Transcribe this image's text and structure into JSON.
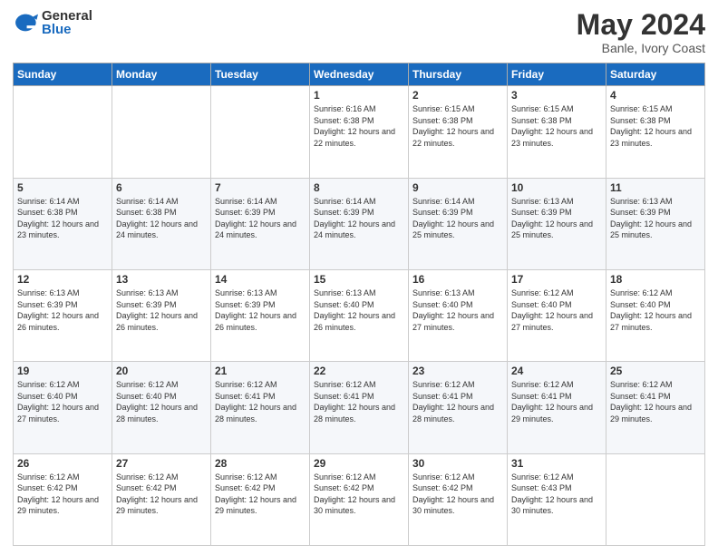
{
  "header": {
    "logo_general": "General",
    "logo_blue": "Blue",
    "month_year": "May 2024",
    "location": "Banle, Ivory Coast"
  },
  "days_of_week": [
    "Sunday",
    "Monday",
    "Tuesday",
    "Wednesday",
    "Thursday",
    "Friday",
    "Saturday"
  ],
  "weeks": [
    [
      {
        "day": "",
        "sunrise": "",
        "sunset": "",
        "daylight": ""
      },
      {
        "day": "",
        "sunrise": "",
        "sunset": "",
        "daylight": ""
      },
      {
        "day": "",
        "sunrise": "",
        "sunset": "",
        "daylight": ""
      },
      {
        "day": "1",
        "sunrise": "Sunrise: 6:16 AM",
        "sunset": "Sunset: 6:38 PM",
        "daylight": "Daylight: 12 hours and 22 minutes."
      },
      {
        "day": "2",
        "sunrise": "Sunrise: 6:15 AM",
        "sunset": "Sunset: 6:38 PM",
        "daylight": "Daylight: 12 hours and 22 minutes."
      },
      {
        "day": "3",
        "sunrise": "Sunrise: 6:15 AM",
        "sunset": "Sunset: 6:38 PM",
        "daylight": "Daylight: 12 hours and 23 minutes."
      },
      {
        "day": "4",
        "sunrise": "Sunrise: 6:15 AM",
        "sunset": "Sunset: 6:38 PM",
        "daylight": "Daylight: 12 hours and 23 minutes."
      }
    ],
    [
      {
        "day": "5",
        "sunrise": "Sunrise: 6:14 AM",
        "sunset": "Sunset: 6:38 PM",
        "daylight": "Daylight: 12 hours and 23 minutes."
      },
      {
        "day": "6",
        "sunrise": "Sunrise: 6:14 AM",
        "sunset": "Sunset: 6:38 PM",
        "daylight": "Daylight: 12 hours and 24 minutes."
      },
      {
        "day": "7",
        "sunrise": "Sunrise: 6:14 AM",
        "sunset": "Sunset: 6:39 PM",
        "daylight": "Daylight: 12 hours and 24 minutes."
      },
      {
        "day": "8",
        "sunrise": "Sunrise: 6:14 AM",
        "sunset": "Sunset: 6:39 PM",
        "daylight": "Daylight: 12 hours and 24 minutes."
      },
      {
        "day": "9",
        "sunrise": "Sunrise: 6:14 AM",
        "sunset": "Sunset: 6:39 PM",
        "daylight": "Daylight: 12 hours and 25 minutes."
      },
      {
        "day": "10",
        "sunrise": "Sunrise: 6:13 AM",
        "sunset": "Sunset: 6:39 PM",
        "daylight": "Daylight: 12 hours and 25 minutes."
      },
      {
        "day": "11",
        "sunrise": "Sunrise: 6:13 AM",
        "sunset": "Sunset: 6:39 PM",
        "daylight": "Daylight: 12 hours and 25 minutes."
      }
    ],
    [
      {
        "day": "12",
        "sunrise": "Sunrise: 6:13 AM",
        "sunset": "Sunset: 6:39 PM",
        "daylight": "Daylight: 12 hours and 26 minutes."
      },
      {
        "day": "13",
        "sunrise": "Sunrise: 6:13 AM",
        "sunset": "Sunset: 6:39 PM",
        "daylight": "Daylight: 12 hours and 26 minutes."
      },
      {
        "day": "14",
        "sunrise": "Sunrise: 6:13 AM",
        "sunset": "Sunset: 6:39 PM",
        "daylight": "Daylight: 12 hours and 26 minutes."
      },
      {
        "day": "15",
        "sunrise": "Sunrise: 6:13 AM",
        "sunset": "Sunset: 6:40 PM",
        "daylight": "Daylight: 12 hours and 26 minutes."
      },
      {
        "day": "16",
        "sunrise": "Sunrise: 6:13 AM",
        "sunset": "Sunset: 6:40 PM",
        "daylight": "Daylight: 12 hours and 27 minutes."
      },
      {
        "day": "17",
        "sunrise": "Sunrise: 6:12 AM",
        "sunset": "Sunset: 6:40 PM",
        "daylight": "Daylight: 12 hours and 27 minutes."
      },
      {
        "day": "18",
        "sunrise": "Sunrise: 6:12 AM",
        "sunset": "Sunset: 6:40 PM",
        "daylight": "Daylight: 12 hours and 27 minutes."
      }
    ],
    [
      {
        "day": "19",
        "sunrise": "Sunrise: 6:12 AM",
        "sunset": "Sunset: 6:40 PM",
        "daylight": "Daylight: 12 hours and 27 minutes."
      },
      {
        "day": "20",
        "sunrise": "Sunrise: 6:12 AM",
        "sunset": "Sunset: 6:40 PM",
        "daylight": "Daylight: 12 hours and 28 minutes."
      },
      {
        "day": "21",
        "sunrise": "Sunrise: 6:12 AM",
        "sunset": "Sunset: 6:41 PM",
        "daylight": "Daylight: 12 hours and 28 minutes."
      },
      {
        "day": "22",
        "sunrise": "Sunrise: 6:12 AM",
        "sunset": "Sunset: 6:41 PM",
        "daylight": "Daylight: 12 hours and 28 minutes."
      },
      {
        "day": "23",
        "sunrise": "Sunrise: 6:12 AM",
        "sunset": "Sunset: 6:41 PM",
        "daylight": "Daylight: 12 hours and 28 minutes."
      },
      {
        "day": "24",
        "sunrise": "Sunrise: 6:12 AM",
        "sunset": "Sunset: 6:41 PM",
        "daylight": "Daylight: 12 hours and 29 minutes."
      },
      {
        "day": "25",
        "sunrise": "Sunrise: 6:12 AM",
        "sunset": "Sunset: 6:41 PM",
        "daylight": "Daylight: 12 hours and 29 minutes."
      }
    ],
    [
      {
        "day": "26",
        "sunrise": "Sunrise: 6:12 AM",
        "sunset": "Sunset: 6:42 PM",
        "daylight": "Daylight: 12 hours and 29 minutes."
      },
      {
        "day": "27",
        "sunrise": "Sunrise: 6:12 AM",
        "sunset": "Sunset: 6:42 PM",
        "daylight": "Daylight: 12 hours and 29 minutes."
      },
      {
        "day": "28",
        "sunrise": "Sunrise: 6:12 AM",
        "sunset": "Sunset: 6:42 PM",
        "daylight": "Daylight: 12 hours and 29 minutes."
      },
      {
        "day": "29",
        "sunrise": "Sunrise: 6:12 AM",
        "sunset": "Sunset: 6:42 PM",
        "daylight": "Daylight: 12 hours and 30 minutes."
      },
      {
        "day": "30",
        "sunrise": "Sunrise: 6:12 AM",
        "sunset": "Sunset: 6:42 PM",
        "daylight": "Daylight: 12 hours and 30 minutes."
      },
      {
        "day": "31",
        "sunrise": "Sunrise: 6:12 AM",
        "sunset": "Sunset: 6:43 PM",
        "daylight": "Daylight: 12 hours and 30 minutes."
      },
      {
        "day": "",
        "sunrise": "",
        "sunset": "",
        "daylight": ""
      }
    ]
  ]
}
